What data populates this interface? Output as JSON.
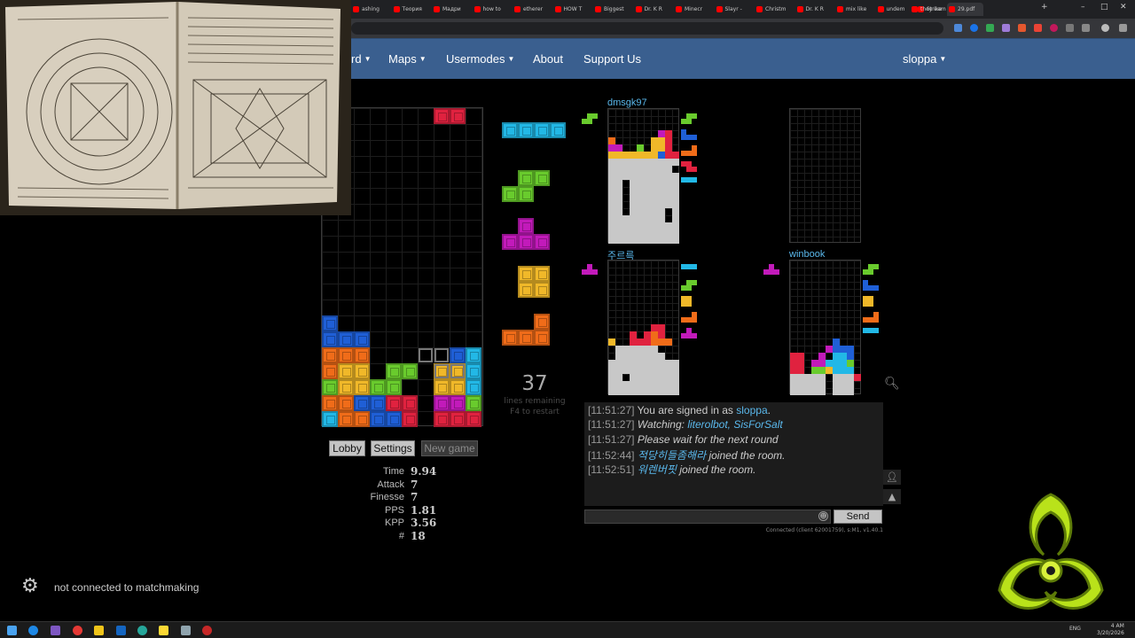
{
  "browser": {
    "tabs": [
      {
        "title": "ashing"
      },
      {
        "title": "Теория"
      },
      {
        "title": "Мадри"
      },
      {
        "title": "how to"
      },
      {
        "title": "etherer"
      },
      {
        "title": "HOW T"
      },
      {
        "title": "Biggest"
      },
      {
        "title": "Dr. K R"
      },
      {
        "title": "Minecr"
      },
      {
        "title": "Slayr -"
      },
      {
        "title": "Christm"
      },
      {
        "title": "Dr. K R"
      },
      {
        "title": "mix like"
      },
      {
        "title": "undem"
      },
      {
        "title": "Stream"
      },
      {
        "title": "they ike"
      },
      {
        "title": "29.pdf"
      }
    ],
    "new_tab": "+",
    "window_controls": {
      "minimize": "–",
      "maximize": "□",
      "close": "✕"
    }
  },
  "nav": {
    "truncated_item": "rd",
    "maps": "Maps",
    "usermodes": "Usermodes",
    "about": "About",
    "support": "Support Us",
    "user": "sloppa"
  },
  "game": {
    "lines_remaining": "37",
    "lines_remaining_label": "lines remaining",
    "restart_hint": "F4 to restart",
    "buttons": {
      "lobby": "Lobby",
      "settings": "Settings",
      "new_game": "New game"
    },
    "stats": [
      {
        "label": "Time",
        "value": "9.94"
      },
      {
        "label": "Attack",
        "value": "7"
      },
      {
        "label": "Finesse",
        "value": "7"
      },
      {
        "label": "PPS",
        "value": "1.81"
      },
      {
        "label": "KPP",
        "value": "3.56"
      },
      {
        "label": "#",
        "value": "18"
      }
    ],
    "opponents": [
      {
        "name": "dmsgk97"
      },
      {
        "name": "주르륵"
      },
      {
        "name": "winbook"
      }
    ]
  },
  "chat": {
    "lines": [
      {
        "time": "[11:51:27]",
        "pre": "You are signed in as ",
        "nick": "sloppa",
        "post": "."
      },
      {
        "time": "[11:51:27]",
        "pre": "Watching: ",
        "nick": "literolbot, SisForSalt",
        "post": ""
      },
      {
        "time": "[11:51:27]",
        "pre": "Please wait for the next round",
        "nick": "",
        "post": ""
      },
      {
        "time": "[11:52:44]",
        "pre": "",
        "nick": "적당히들좀해라",
        "post": " joined the room."
      },
      {
        "time": "[11:52:51]",
        "pre": "",
        "nick": "워렌버핏",
        "post": " joined the room."
      }
    ],
    "send": "Send",
    "input_value": "",
    "connection": "Connected (client 62001759), s:M1, v1.40.1"
  },
  "overlay": {
    "matchmaking_status": "not connected to matchmaking"
  },
  "taskbar": {
    "language": "ENG",
    "time": "4 AM",
    "date": "3/20/2026"
  },
  "colors": {
    "I": "#22b8e6",
    "O": "#f0b829",
    "T": "#c21aba",
    "S": "#69cb2d",
    "Z": "#e0223f",
    "J": "#1f5fd6",
    "L": "#f06c19",
    "garbage": "#c8c8c8",
    "nav_bg": "#3a5f8f",
    "link": "#5ab8ec"
  },
  "main_board": [
    "..........",
    "..........",
    "..........",
    "..........",
    "..........",
    "..........",
    "..........",
    "..........",
    "..........",
    "..........",
    "..........",
    "..........",
    "J.........",
    "JJJ.......",
    "LLL.....JI",
    "LOO.SS.OOI",
    "SOOSS..OOI",
    "LLJJZZ.TTS",
    "ILLJJZ.ZZZ"
  ],
  "main_active": {
    "piece": "Z",
    "cells": [
      [
        0,
        7
      ],
      [
        0,
        8
      ]
    ]
  },
  "main_ghost": {
    "cells": [
      [
        14,
        6
      ],
      [
        14,
        7
      ],
      [
        15,
        7
      ],
      [
        15,
        8
      ]
    ]
  },
  "queue": [
    "I",
    "S",
    "T",
    "O",
    "L"
  ],
  "dmsgk97_board": [
    "..........",
    "..........",
    "..........",
    ".......TZ.",
    "L.....OOZ.",
    "TT..S.OOZ.",
    "OOOOOOOJZZ",
    "GGGGGGGGGG",
    "GGGGGGGGG.",
    "GGGGGGGGGG",
    "GG.GGGGGGG",
    "GG.GGGGGGG",
    "GG.GGGGGGG",
    "GG.GGGGGGG",
    "GG.GGGGG.G",
    "GGGGGGGG.G",
    "GGGGGGGGGG",
    "GGGGGGGGGG",
    "GGGGGGGGGG"
  ],
  "dmsgk97_queue": [
    "S",
    "J",
    "L",
    "Z",
    "I"
  ],
  "dmsgk97_hold": "S",
  "korean_board": [
    "..........",
    "..........",
    "..........",
    "..........",
    "..........",
    "..........",
    "..........",
    "..........",
    "......ZZ..",
    "...Z.ZLZ..",
    "O..ZZZLLL.",
    ".GGGGGG...",
    ".GGGGGGG..",
    "GGGGGGGGGG",
    "GGGGGGGGGG",
    "GG.GGGGGGG",
    "GGGGGGGGGG",
    "GGGGGGGGGG"
  ],
  "korean_queue": [
    "I",
    "S",
    "O",
    "L",
    "T"
  ],
  "korean_hold": "T",
  "winbook_board": [
    "..........",
    "..........",
    "..........",
    "..........",
    "..........",
    "..........",
    "..........",
    "..........",
    "..........",
    "..........",
    "......J...",
    ".....TJJJ.",
    "ZZ..T.IIJ.",
    "ZZ.TTIIIS.",
    "ZZ.SSOIII.",
    "GGGGG.GGGZ",
    "GGGGG.GGG.",
    "GGGGG.GGG."
  ],
  "winbook_queue": [
    "S",
    "J",
    "O",
    "L",
    "I"
  ],
  "winbook_hold": "T"
}
